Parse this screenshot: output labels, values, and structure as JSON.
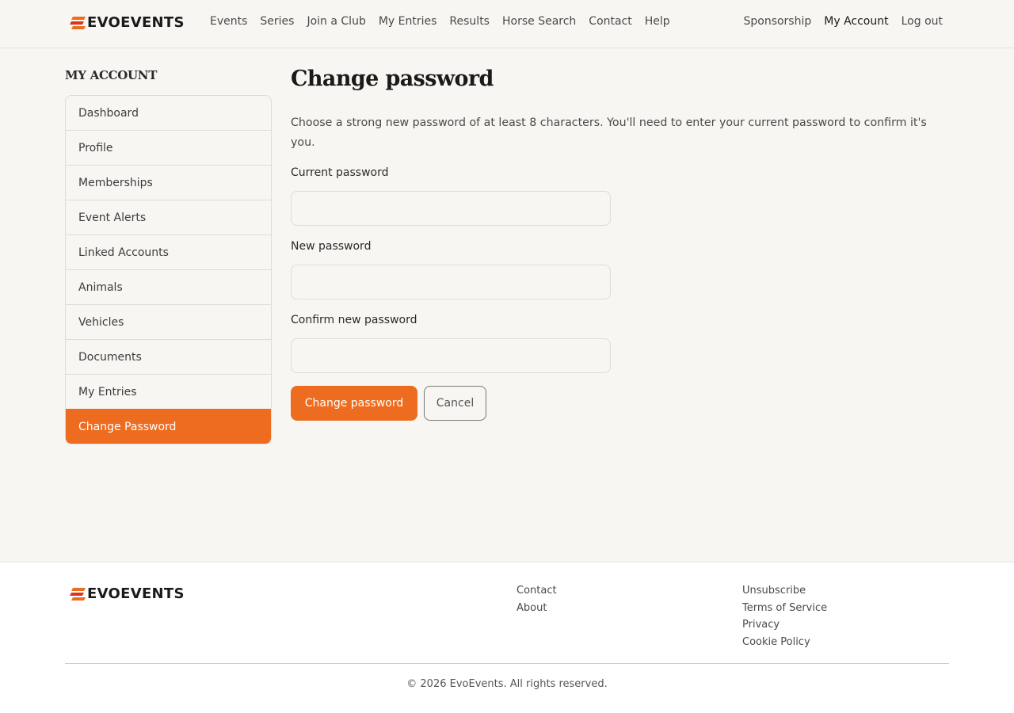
{
  "brand": {
    "name": "EVOEVENTS",
    "accent_color": "#ee6c1f"
  },
  "nav": {
    "main": [
      "Events",
      "Series",
      "Join a Club",
      "My Entries",
      "Results",
      "Horse Search",
      "Contact",
      "Help"
    ],
    "right": [
      "Sponsorship",
      "My Account",
      "Log out"
    ],
    "active": "My Account"
  },
  "sidebar": {
    "heading": "MY ACCOUNT",
    "items": [
      {
        "label": "Dashboard"
      },
      {
        "label": "Profile"
      },
      {
        "label": "Memberships"
      },
      {
        "label": "Event Alerts"
      },
      {
        "label": "Linked Accounts"
      },
      {
        "label": "Animals"
      },
      {
        "label": "Vehicles"
      },
      {
        "label": "Documents"
      },
      {
        "label": "My Entries"
      },
      {
        "label": "Change Password"
      }
    ],
    "active": "Change Password"
  },
  "main": {
    "title": "Change password",
    "intro": "Choose a strong new password of at least 8 characters. You'll need to enter your current password to confirm it's you.",
    "fields": {
      "current": {
        "label": "Current password",
        "value": ""
      },
      "new": {
        "label": "New password",
        "value": ""
      },
      "confirm": {
        "label": "Confirm new password",
        "value": ""
      }
    },
    "submit_label": "Change password",
    "cancel_label": "Cancel"
  },
  "footer": {
    "col1": [
      "Contact",
      "About"
    ],
    "col2": [
      "Unsubscribe",
      "Terms of Service",
      "Privacy",
      "Cookie Policy"
    ],
    "copyright": "© 2026 EvoEvents. All rights reserved."
  }
}
